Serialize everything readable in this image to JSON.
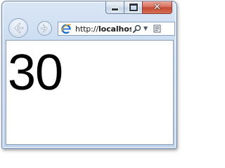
{
  "window": {
    "caption_buttons": {
      "minimize_icon": "minimize-icon",
      "maximize_icon": "maximize-icon",
      "close_icon": "close-icon",
      "close_color": "#c9503a"
    }
  },
  "navigation": {
    "back_icon": "back-arrow-icon",
    "forward_icon": "forward-arrow-icon"
  },
  "address_bar": {
    "scheme": "http://",
    "host": "localhost",
    "site_icon": "ie-logo-icon",
    "search_icon": "search-icon",
    "dropdown_icon": "chevron-down-icon",
    "compat_icon": "compatibility-view-icon"
  },
  "page": {
    "content_text": "30"
  },
  "colors": {
    "frame": "#c7d9ef",
    "frame_border": "#7d8ea6",
    "content_bg": "#ffffff",
    "text": "#000000"
  }
}
